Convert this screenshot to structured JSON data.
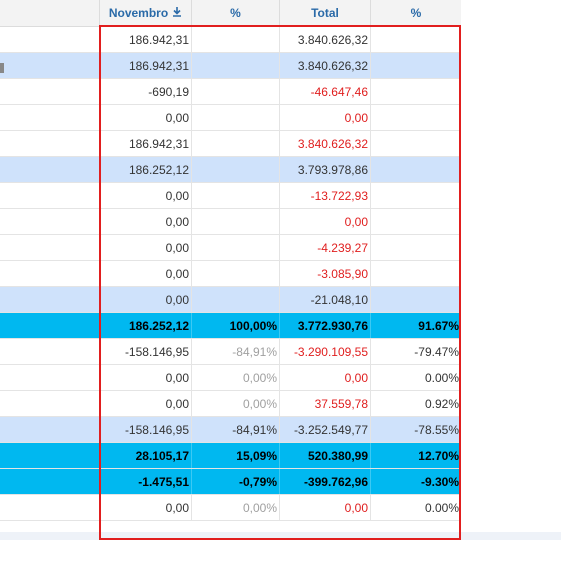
{
  "header": {
    "col1": "Novembro",
    "col2": "%",
    "col3": "Total",
    "col4": "%",
    "download_icon": "download-icon"
  },
  "rows": [
    {
      "style": "plain",
      "v": "186.942,31",
      "p": "",
      "t": "3.840.626,32",
      "tp": "",
      "tneg": false,
      "pm": false
    },
    {
      "style": "light",
      "v": "186.942,31",
      "p": "",
      "t": "3.840.626,32",
      "tp": "",
      "tneg": false,
      "pm": false
    },
    {
      "style": "plain",
      "v": "-690,19",
      "p": "",
      "t": "-46.647,46",
      "tp": "",
      "tneg": true,
      "pm": false
    },
    {
      "style": "plain",
      "v": "0,00",
      "p": "",
      "t": "0,00",
      "tp": "",
      "tneg": true,
      "pm": false
    },
    {
      "style": "plain",
      "v": "186.942,31",
      "p": "",
      "t": "3.840.626,32",
      "tp": "",
      "tneg": true,
      "pm": false
    },
    {
      "style": "light",
      "v": "186.252,12",
      "p": "",
      "t": "3.793.978,86",
      "tp": "",
      "tneg": false,
      "pm": false
    },
    {
      "style": "plain",
      "v": "0,00",
      "p": "",
      "t": "-13.722,93",
      "tp": "",
      "tneg": true,
      "pm": false
    },
    {
      "style": "plain",
      "v": "0,00",
      "p": "",
      "t": "0,00",
      "tp": "",
      "tneg": true,
      "pm": false
    },
    {
      "style": "plain",
      "v": "0,00",
      "p": "",
      "t": "-4.239,27",
      "tp": "",
      "tneg": true,
      "pm": false
    },
    {
      "style": "plain",
      "v": "0,00",
      "p": "",
      "t": "-3.085,90",
      "tp": "",
      "tneg": true,
      "pm": false
    },
    {
      "style": "light",
      "v": "0,00",
      "p": "",
      "t": "-21.048,10",
      "tp": "",
      "tneg": false,
      "pm": false
    },
    {
      "style": "strong",
      "v": "186.252,12",
      "p": "100,00%",
      "t": "3.772.930,76",
      "tp": "91.67%",
      "tneg": false,
      "pm": false
    },
    {
      "style": "plain",
      "v": "-158.146,95",
      "p": "-84,91%",
      "t": "-3.290.109,55",
      "tp": "-79.47%",
      "tneg": true,
      "pm": true
    },
    {
      "style": "plain",
      "v": "0,00",
      "p": "0,00%",
      "t": "0,00",
      "tp": "0.00%",
      "tneg": true,
      "pm": true
    },
    {
      "style": "plain",
      "v": "0,00",
      "p": "0,00%",
      "t": "37.559,78",
      "tp": "0.92%",
      "tneg": true,
      "pm": true
    },
    {
      "style": "light",
      "v": "-158.146,95",
      "p": "-84,91%",
      "t": "-3.252.549,77",
      "tp": "-78.55%",
      "tneg": false,
      "pm": false
    },
    {
      "style": "strong",
      "v": "28.105,17",
      "p": "15,09%",
      "t": "520.380,99",
      "tp": "12.70%",
      "tneg": false,
      "pm": false
    },
    {
      "style": "strong",
      "v": "-1.475,51",
      "p": "-0,79%",
      "t": "-399.762,96",
      "tp": "-9.30%",
      "tneg": false,
      "pm": false
    },
    {
      "style": "plain",
      "v": "0,00",
      "p": "0,00%",
      "t": "0,00",
      "tp": "0.00%",
      "tneg": true,
      "pm": true
    }
  ]
}
